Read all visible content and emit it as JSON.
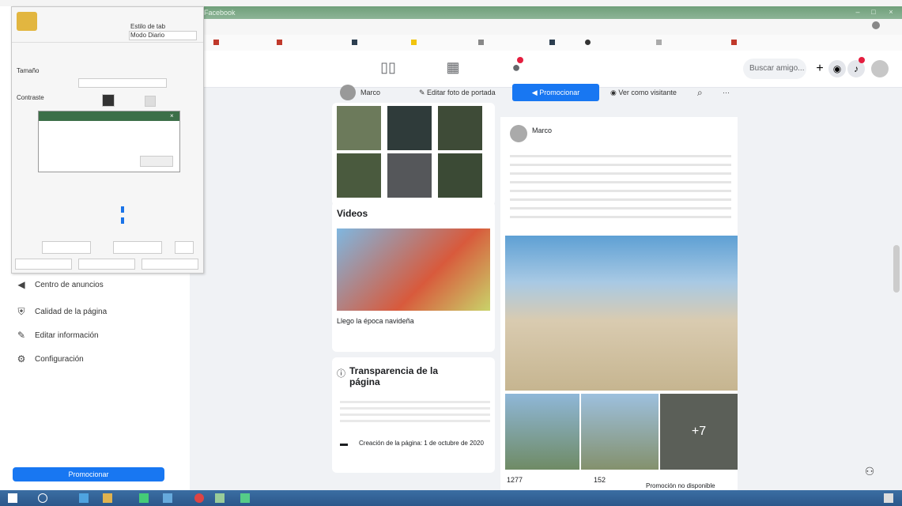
{
  "browser": {
    "tab_title": "Facebook",
    "url": "",
    "bookmarks": [
      "",
      "",
      "",
      "",
      "",
      "",
      "",
      "",
      "",
      "",
      ""
    ]
  },
  "header": {
    "search_placeholder": "Buscar amigo..."
  },
  "editor": {
    "title": "",
    "rows": [
      {
        "label": "Estilo de tab",
        "value": "Modo Diario"
      },
      {
        "label": "",
        "value": ""
      },
      {
        "label": "Tamaño",
        "value": ""
      },
      {
        "label": "Contraste",
        "value": ""
      }
    ],
    "popup_title": "",
    "popup_text": "",
    "bottom_buttons": [
      "",
      "",
      ""
    ],
    "footer_labels": [
      "",
      "",
      ""
    ]
  },
  "left_menu": [
    {
      "icon": "megaphone-icon",
      "label": "Centro de anuncios"
    },
    {
      "icon": "shield-icon",
      "label": "Calidad de la página"
    },
    {
      "icon": "pencil-icon",
      "label": "Editar información"
    },
    {
      "icon": "gear-icon",
      "label": "Configuración"
    }
  ],
  "left_promote_button": "Promocionar",
  "tabs": {
    "page": "Marco",
    "edit": "Editar foto de portada",
    "promote": "Promocionar",
    "view_as": "Ver como visitante"
  },
  "mid": {
    "videos_title": "Videos",
    "video_caption": "Llego la época navideña",
    "transparency_title": "Transparencia de la página",
    "creation_text": "Creación de la página: 1 de octubre de 2020"
  },
  "post": {
    "author": "Marco",
    "more_photos": "+7",
    "reactions": "1277",
    "comments": "152",
    "promo_note": "Promoción no disponible"
  },
  "colors": {
    "fb_blue": "#1877f2",
    "window_green": "#6f9f79",
    "taskbar": "#2b578a"
  }
}
